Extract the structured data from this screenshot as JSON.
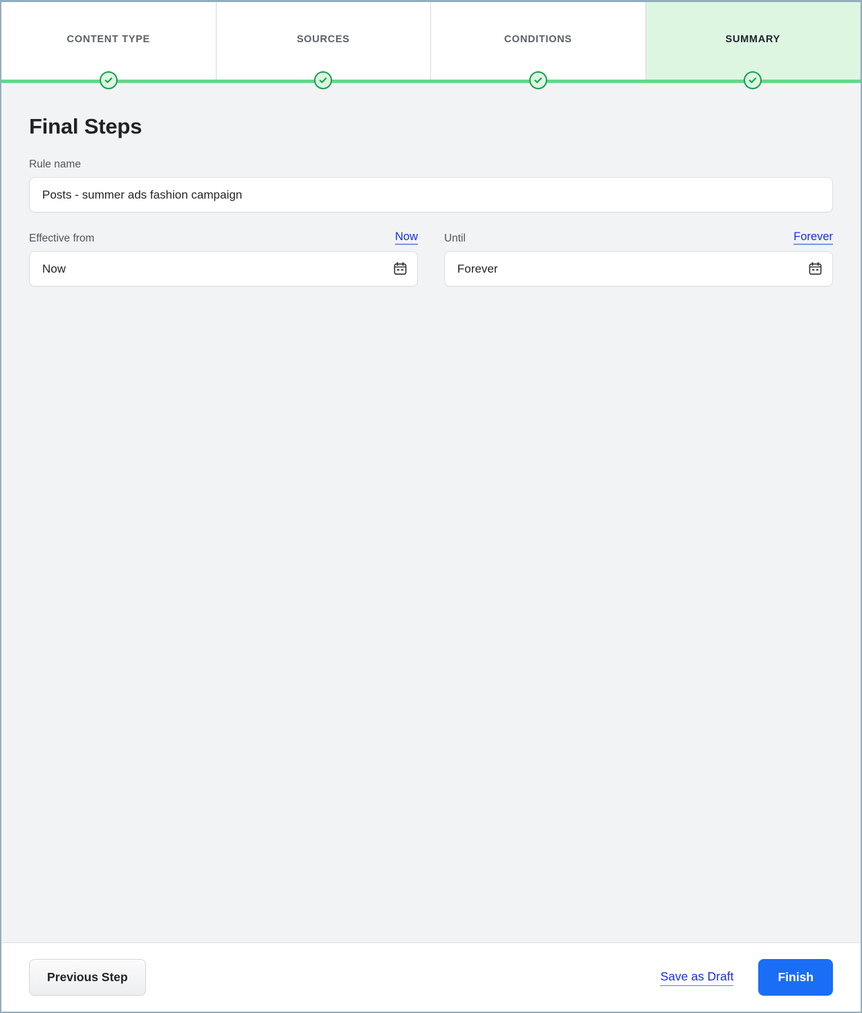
{
  "colors": {
    "accent_green": "#66d68a",
    "step_active_bg": "#ddf6e2",
    "check_ring": "#17a04b",
    "link_blue": "#1430e0",
    "primary_blue": "#1a6ef5",
    "frame_border": "#92aebd",
    "body_bg": "#f1f3f4"
  },
  "stepper": {
    "steps": [
      {
        "label": "CONTENT TYPE",
        "state": "complete",
        "active": false
      },
      {
        "label": "SOURCES",
        "state": "complete",
        "active": false
      },
      {
        "label": "CONDITIONS",
        "state": "complete",
        "active": false
      },
      {
        "label": "SUMMARY",
        "state": "complete",
        "active": true
      }
    ]
  },
  "main": {
    "title": "Final Steps",
    "rule_name": {
      "label": "Rule name",
      "value": "Posts - summer ads fashion campaign",
      "placeholder": "Rule name"
    },
    "effective_from": {
      "label": "Effective from",
      "quick_link": "Now",
      "value": "Now",
      "placeholder": "Now",
      "icon": "calendar-icon"
    },
    "until": {
      "label": "Until",
      "quick_link": "Forever",
      "value": "Forever",
      "placeholder": "Forever",
      "icon": "calendar-icon"
    }
  },
  "footer": {
    "previous_label": "Previous Step",
    "save_draft_label": "Save as Draft",
    "finish_label": "Finish"
  }
}
